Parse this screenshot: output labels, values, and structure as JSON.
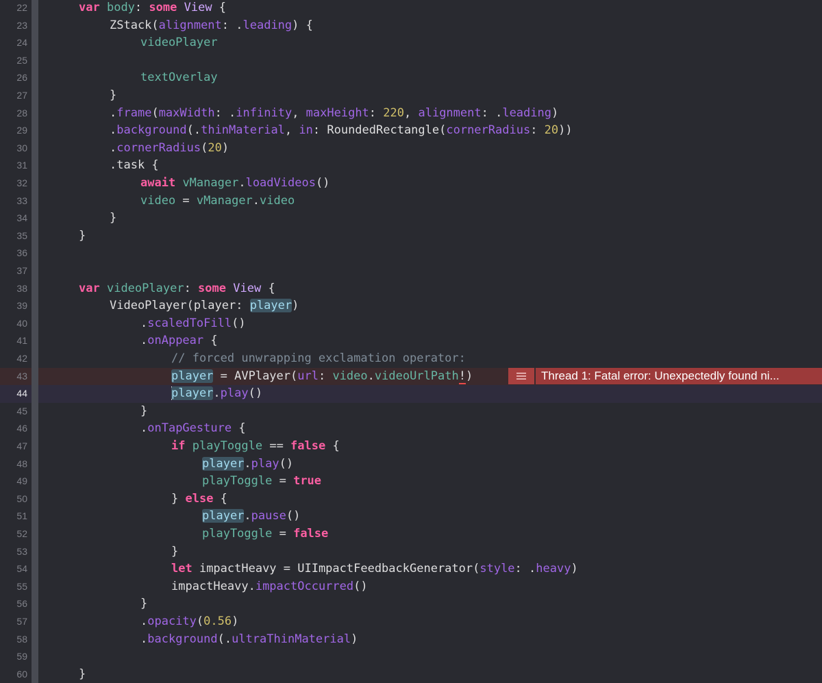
{
  "editor": {
    "theme_colors": {
      "background": "#292a30",
      "keyword": "#fc5fa3",
      "type": "#d0a8ff",
      "function": "#a167e6",
      "property": "#67b7a4",
      "number": "#d0bf69",
      "comment": "#7f8c98",
      "plain": "#dfdfe0",
      "error_background": "#9c3a3a"
    },
    "lines": [
      {
        "n": "22",
        "indent": 1,
        "tokens": [
          [
            "kw",
            "var"
          ],
          [
            "pl",
            " "
          ],
          [
            "prop",
            "body"
          ],
          [
            "pl",
            ": "
          ],
          [
            "kw",
            "some"
          ],
          [
            "pl",
            " "
          ],
          [
            "ty",
            "View"
          ],
          [
            "pl",
            " {"
          ]
        ]
      },
      {
        "n": "23",
        "indent": 2,
        "tokens": [
          [
            "pl",
            "ZStack("
          ],
          [
            "fn",
            "alignment"
          ],
          [
            "pl",
            ": ."
          ],
          [
            "fn",
            "leading"
          ],
          [
            "pl",
            ") {"
          ]
        ]
      },
      {
        "n": "24",
        "indent": 3,
        "tokens": [
          [
            "prop",
            "videoPlayer"
          ]
        ]
      },
      {
        "n": "25",
        "indent": 0,
        "tokens": []
      },
      {
        "n": "26",
        "indent": 3,
        "tokens": [
          [
            "prop",
            "textOverlay"
          ]
        ]
      },
      {
        "n": "27",
        "indent": 2,
        "tokens": [
          [
            "pl",
            "}"
          ]
        ]
      },
      {
        "n": "28",
        "indent": 2,
        "tokens": [
          [
            "pl",
            "."
          ],
          [
            "fn",
            "frame"
          ],
          [
            "pl",
            "("
          ],
          [
            "fn",
            "maxWidth"
          ],
          [
            "pl",
            ": ."
          ],
          [
            "fn",
            "infinity"
          ],
          [
            "pl",
            ", "
          ],
          [
            "fn",
            "maxHeight"
          ],
          [
            "pl",
            ": "
          ],
          [
            "num",
            "220"
          ],
          [
            "pl",
            ", "
          ],
          [
            "fn",
            "alignment"
          ],
          [
            "pl",
            ": ."
          ],
          [
            "fn",
            "leading"
          ],
          [
            "pl",
            ")"
          ]
        ]
      },
      {
        "n": "29",
        "indent": 2,
        "tokens": [
          [
            "pl",
            "."
          ],
          [
            "fn",
            "background"
          ],
          [
            "pl",
            "(."
          ],
          [
            "fn",
            "thinMaterial"
          ],
          [
            "pl",
            ", "
          ],
          [
            "fn",
            "in"
          ],
          [
            "pl",
            ": RoundedRectangle("
          ],
          [
            "fn",
            "cornerRadius"
          ],
          [
            "pl",
            ": "
          ],
          [
            "num",
            "20"
          ],
          [
            "pl",
            "))"
          ]
        ]
      },
      {
        "n": "30",
        "indent": 2,
        "tokens": [
          [
            "pl",
            "."
          ],
          [
            "fn",
            "cornerRadius"
          ],
          [
            "pl",
            "("
          ],
          [
            "num",
            "20"
          ],
          [
            "pl",
            ")"
          ]
        ]
      },
      {
        "n": "31",
        "indent": 2,
        "tokens": [
          [
            "pl",
            ".task {"
          ]
        ]
      },
      {
        "n": "32",
        "indent": 3,
        "tokens": [
          [
            "kw",
            "await"
          ],
          [
            "pl",
            " "
          ],
          [
            "prop",
            "vManager"
          ],
          [
            "pl",
            "."
          ],
          [
            "fn",
            "loadVideos"
          ],
          [
            "pl",
            "()"
          ]
        ]
      },
      {
        "n": "33",
        "indent": 3,
        "tokens": [
          [
            "prop",
            "video"
          ],
          [
            "pl",
            " = "
          ],
          [
            "prop",
            "vManager"
          ],
          [
            "pl",
            "."
          ],
          [
            "prop",
            "video"
          ]
        ]
      },
      {
        "n": "34",
        "indent": 2,
        "tokens": [
          [
            "pl",
            "}"
          ]
        ]
      },
      {
        "n": "35",
        "indent": 1,
        "tokens": [
          [
            "pl",
            "}"
          ]
        ]
      },
      {
        "n": "36",
        "indent": 0,
        "tokens": []
      },
      {
        "n": "37",
        "indent": 0,
        "tokens": []
      },
      {
        "n": "38",
        "indent": 1,
        "tokens": [
          [
            "kw",
            "var"
          ],
          [
            "pl",
            " "
          ],
          [
            "prop",
            "videoPlayer"
          ],
          [
            "pl",
            ": "
          ],
          [
            "kw",
            "some"
          ],
          [
            "pl",
            " "
          ],
          [
            "ty",
            "View"
          ],
          [
            "pl",
            " {"
          ]
        ]
      },
      {
        "n": "39",
        "indent": 2,
        "tokens": [
          [
            "pl",
            "VideoPlayer(player: "
          ],
          [
            "hl",
            "player"
          ],
          [
            "pl",
            ")"
          ]
        ]
      },
      {
        "n": "40",
        "indent": 3,
        "tokens": [
          [
            "pl",
            "."
          ],
          [
            "fn",
            "scaledToFill"
          ],
          [
            "pl",
            "()"
          ]
        ]
      },
      {
        "n": "41",
        "indent": 3,
        "tokens": [
          [
            "pl",
            "."
          ],
          [
            "fn",
            "onAppear"
          ],
          [
            "pl",
            " {"
          ]
        ]
      },
      {
        "n": "42",
        "indent": 4,
        "tokens": [
          [
            "cm",
            "// forced unwrapping exclamation operator:"
          ]
        ]
      },
      {
        "n": "43",
        "indent": 4,
        "tokens": [
          [
            "hl",
            "player"
          ],
          [
            "pl",
            " = AVPlayer("
          ],
          [
            "fn",
            "url"
          ],
          [
            "pl",
            ": "
          ],
          [
            "prop",
            "video"
          ],
          [
            "pl",
            "."
          ],
          [
            "prop",
            "videoUrlPath"
          ],
          [
            "bang",
            "!"
          ],
          [
            "pl",
            ")"
          ]
        ]
      },
      {
        "n": "44",
        "indent": 4,
        "tokens": [
          [
            "caret",
            ""
          ],
          [
            "hl",
            "player"
          ],
          [
            "pl",
            "."
          ],
          [
            "fn",
            "play"
          ],
          [
            "pl",
            "()"
          ]
        ]
      },
      {
        "n": "45",
        "indent": 3,
        "tokens": [
          [
            "pl",
            "}"
          ]
        ]
      },
      {
        "n": "46",
        "indent": 3,
        "tokens": [
          [
            "pl",
            "."
          ],
          [
            "fn",
            "onTapGesture"
          ],
          [
            "pl",
            " {"
          ]
        ]
      },
      {
        "n": "47",
        "indent": 4,
        "tokens": [
          [
            "kw",
            "if"
          ],
          [
            "pl",
            " "
          ],
          [
            "prop",
            "playToggle"
          ],
          [
            "pl",
            " == "
          ],
          [
            "kw",
            "false"
          ],
          [
            "pl",
            " {"
          ]
        ]
      },
      {
        "n": "48",
        "indent": 5,
        "tokens": [
          [
            "hl",
            "player"
          ],
          [
            "pl",
            "."
          ],
          [
            "fn",
            "play"
          ],
          [
            "pl",
            "()"
          ]
        ]
      },
      {
        "n": "49",
        "indent": 5,
        "tokens": [
          [
            "prop",
            "playToggle"
          ],
          [
            "pl",
            " = "
          ],
          [
            "kw",
            "true"
          ]
        ]
      },
      {
        "n": "50",
        "indent": 4,
        "tokens": [
          [
            "pl",
            "} "
          ],
          [
            "kw",
            "else"
          ],
          [
            "pl",
            " {"
          ]
        ]
      },
      {
        "n": "51",
        "indent": 5,
        "tokens": [
          [
            "hl",
            "player"
          ],
          [
            "pl",
            "."
          ],
          [
            "fn",
            "pause"
          ],
          [
            "pl",
            "()"
          ]
        ]
      },
      {
        "n": "52",
        "indent": 5,
        "tokens": [
          [
            "prop",
            "playToggle"
          ],
          [
            "pl",
            " = "
          ],
          [
            "kw",
            "false"
          ]
        ]
      },
      {
        "n": "53",
        "indent": 4,
        "tokens": [
          [
            "pl",
            "}"
          ]
        ]
      },
      {
        "n": "54",
        "indent": 4,
        "tokens": [
          [
            "kw",
            "let"
          ],
          [
            "pl",
            " impactHeavy = UIImpactFeedbackGenerator("
          ],
          [
            "fn",
            "style"
          ],
          [
            "pl",
            ": ."
          ],
          [
            "fn",
            "heavy"
          ],
          [
            "pl",
            ")"
          ]
        ]
      },
      {
        "n": "55",
        "indent": 4,
        "tokens": [
          [
            "pl",
            "impactHeavy."
          ],
          [
            "fn",
            "impactOccurred"
          ],
          [
            "pl",
            "()"
          ]
        ]
      },
      {
        "n": "56",
        "indent": 3,
        "tokens": [
          [
            "pl",
            "}"
          ]
        ]
      },
      {
        "n": "57",
        "indent": 3,
        "tokens": [
          [
            "pl",
            "."
          ],
          [
            "fn",
            "opacity"
          ],
          [
            "pl",
            "("
          ],
          [
            "num",
            "0.56"
          ],
          [
            "pl",
            ")"
          ]
        ]
      },
      {
        "n": "58",
        "indent": 3,
        "tokens": [
          [
            "pl",
            "."
          ],
          [
            "fn",
            "background"
          ],
          [
            "pl",
            "(."
          ],
          [
            "fn",
            "ultraThinMaterial"
          ],
          [
            "pl",
            ")"
          ]
        ]
      },
      {
        "n": "59",
        "indent": 0,
        "tokens": []
      },
      {
        "n": "60",
        "indent": 1,
        "tokens": [
          [
            "pl",
            "}"
          ]
        ]
      }
    ],
    "error_line": "43",
    "current_line": "44",
    "error_annotation": {
      "icon": "error-list-icon",
      "message": "Thread 1: Fatal error: Unexpectedly found ni..."
    }
  }
}
